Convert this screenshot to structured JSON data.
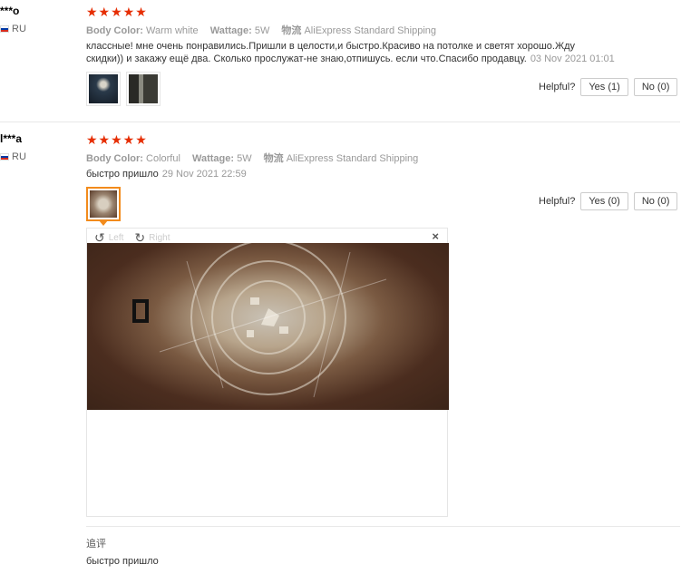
{
  "reviews": [
    {
      "user": "***o",
      "country": "RU",
      "stars": "★★★★★",
      "specs": [
        {
          "key": "Body Color:",
          "value": "Warm white"
        },
        {
          "key": "Wattage:",
          "value": "5W"
        },
        {
          "key": "物流",
          "value": "AliExpress Standard Shipping"
        }
      ],
      "text_line1": "классные! мне очень понравились.Пришли в целости,и быстро.Красиво на потолке и светят хорошо.Жду",
      "text_line2": "скидки)) и закажу ещё два. Сколько прослужат-не знаю,отпишусь. если что.Спасибо продавцу.",
      "date": "03 Nov 2021 01:01",
      "helpful_label": "Helpful?",
      "yes_label": "Yes (1)",
      "no_label": "No (0)"
    },
    {
      "user": "l***a",
      "country": "RU",
      "stars": "★★★★★",
      "specs": [
        {
          "key": "Body Color:",
          "value": "Colorful"
        },
        {
          "key": "Wattage:",
          "value": "5W"
        },
        {
          "key": "物流",
          "value": "AliExpress Standard Shipping"
        }
      ],
      "text_line1": "быстро пришло",
      "date": "29 Nov 2021 22:59",
      "helpful_label": "Helpful?",
      "yes_label": "Yes (0)",
      "no_label": "No (0)"
    }
  ],
  "viewer": {
    "rotate_left_label": "Left",
    "rotate_right_label": "Right",
    "close_icon": "×"
  },
  "additional_feedback": {
    "label": "追评",
    "text": "быстро пришло"
  },
  "colors": {
    "star": "#e62e04",
    "accent_orange": "#f28b1c"
  }
}
